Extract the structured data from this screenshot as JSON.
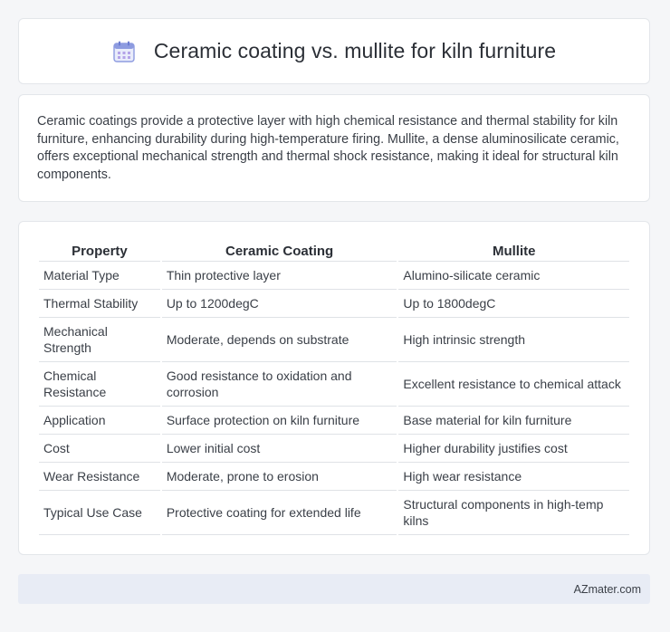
{
  "header": {
    "title": "Ceramic coating vs. mullite for kiln furniture",
    "icon": "calendar-icon"
  },
  "intro": {
    "text": "Ceramic coatings provide a protective layer with high chemical resistance and thermal stability for kiln furniture, enhancing durability during high-temperature firing. Mullite, a dense aluminosilicate ceramic, offers exceptional mechanical strength and thermal shock resistance, making it ideal for structural kiln components."
  },
  "table": {
    "headers": [
      "Property",
      "Ceramic Coating",
      "Mullite"
    ],
    "rows": [
      [
        "Material Type",
        "Thin protective layer",
        "Alumino-silicate ceramic"
      ],
      [
        "Thermal Stability",
        "Up to 1200degC",
        "Up to 1800degC"
      ],
      [
        "Mechanical Strength",
        "Moderate, depends on substrate",
        "High intrinsic strength"
      ],
      [
        "Chemical Resistance",
        "Good resistance to oxidation and corrosion",
        "Excellent resistance to chemical attack"
      ],
      [
        "Application",
        "Surface protection on kiln furniture",
        "Base material for kiln furniture"
      ],
      [
        "Cost",
        "Lower initial cost",
        "Higher durability justifies cost"
      ],
      [
        "Wear Resistance",
        "Moderate, prone to erosion",
        "High wear resistance"
      ],
      [
        "Typical Use Case",
        "Protective coating for extended life",
        "Structural components in high-temp kilns"
      ]
    ]
  },
  "footer": {
    "brand": "AZmater.com"
  }
}
